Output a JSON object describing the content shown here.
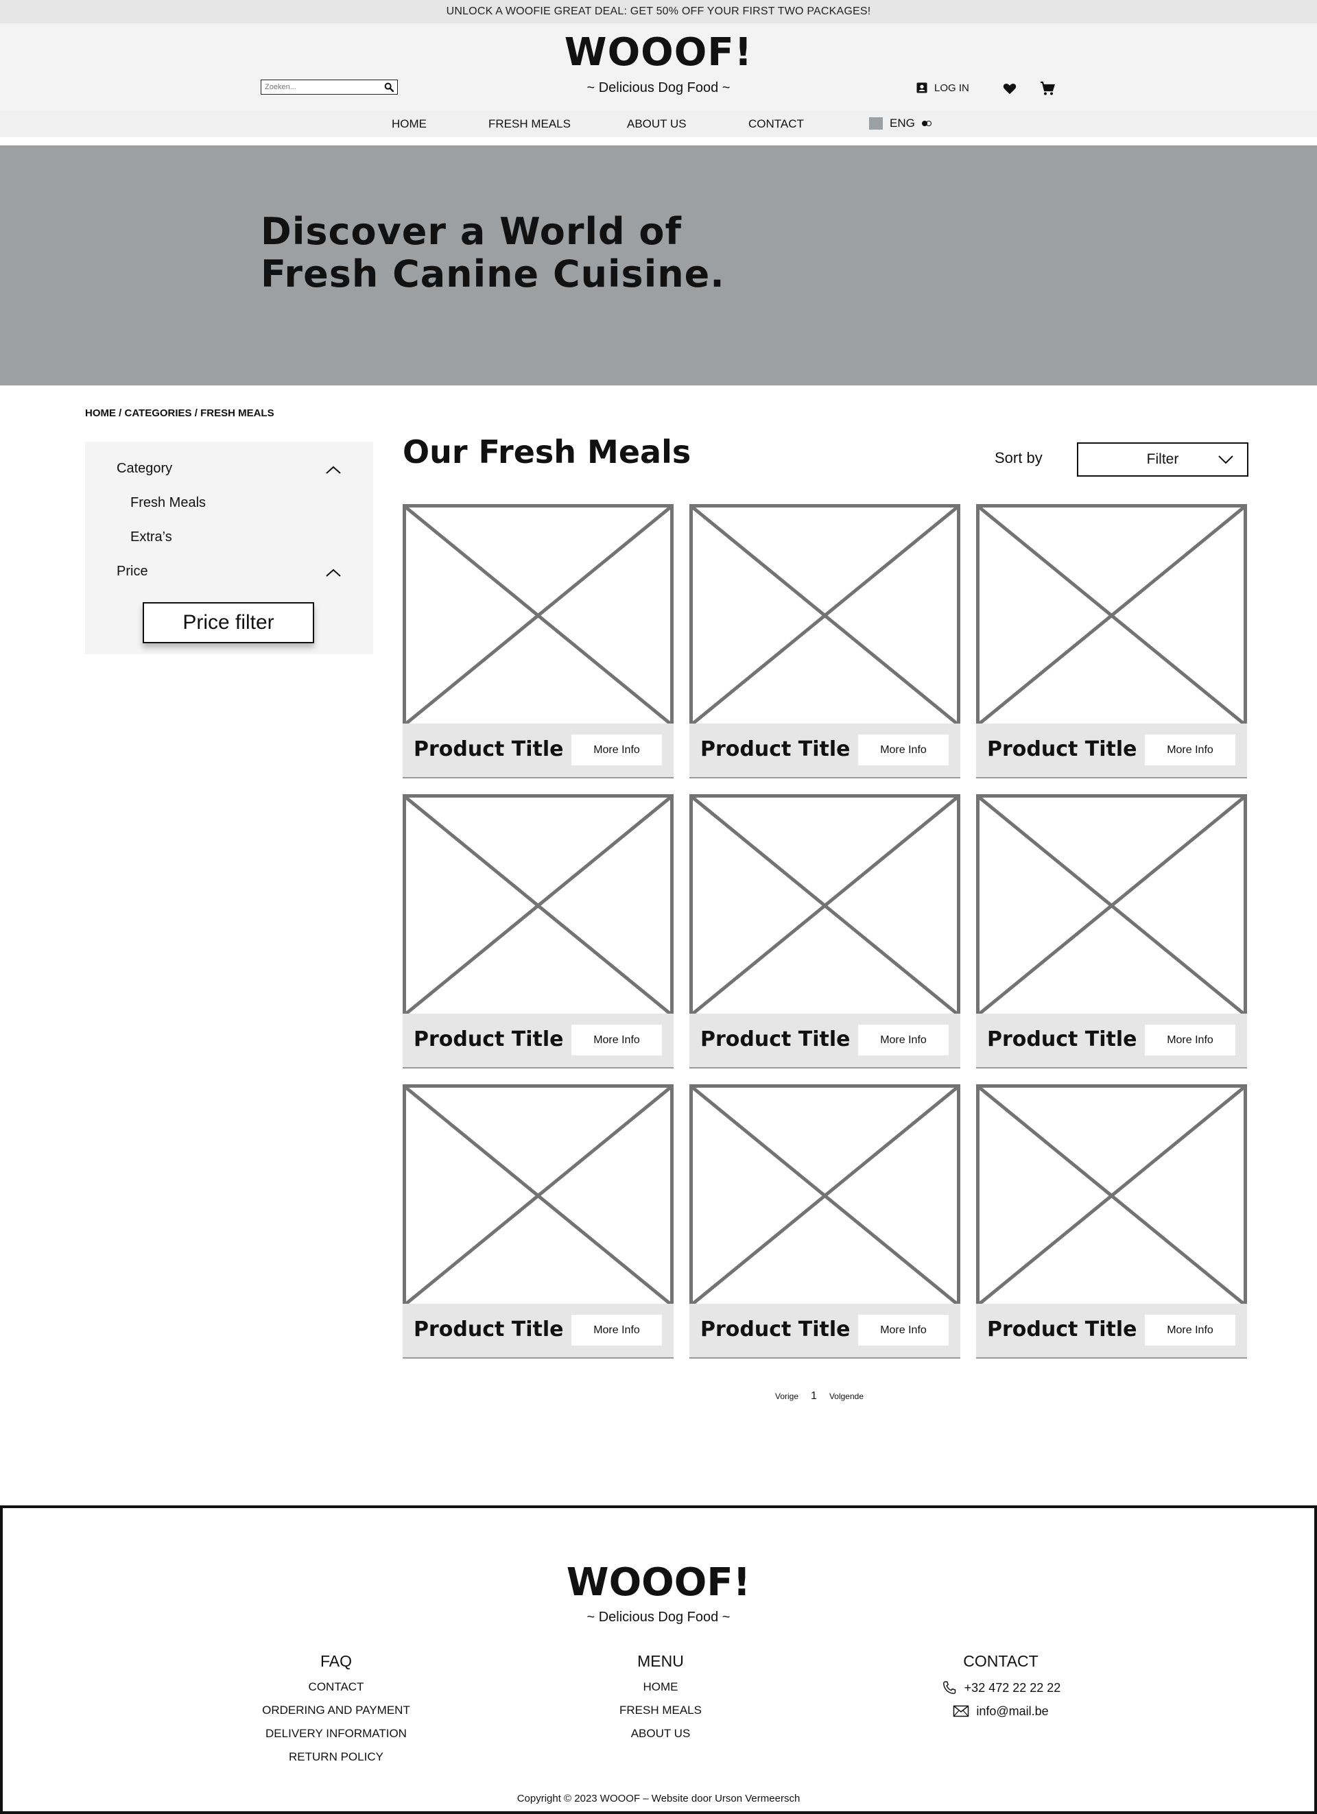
{
  "promo": {
    "text": "UNLOCK A WOOFIE GREAT DEAL: GET 50% OFF YOUR FIRST TWO PACKAGES!"
  },
  "header": {
    "logo": "WOOOF!",
    "tagline": "~ Delicious Dog Food ~",
    "search_placeholder": "Zoeken...",
    "login_label": "LOG IN"
  },
  "nav": {
    "items": [
      "HOME",
      "FRESH MEALS",
      "ABOUT US",
      "CONTACT"
    ],
    "language": "ENG"
  },
  "hero": {
    "title": "Discover a World of Fresh Canine Cuisine."
  },
  "breadcrumb": "HOME / CATEGORIES / FRESH MEALS",
  "sidebar": {
    "category_label": "Category",
    "categories": [
      "Fresh Meals",
      "Extra’s"
    ],
    "price_label": "Price",
    "price_button": "Price filter"
  },
  "main": {
    "title": "Our Fresh Meals",
    "sort_label": "Sort by",
    "sort_value": "Filter"
  },
  "products": [
    {
      "title": "Product Title",
      "button": "More Info"
    },
    {
      "title": "Product Title",
      "button": "More Info"
    },
    {
      "title": "Product Title",
      "button": "More Info"
    },
    {
      "title": "Product Title",
      "button": "More Info"
    },
    {
      "title": "Product Title",
      "button": "More Info"
    },
    {
      "title": "Product Title",
      "button": "More Info"
    },
    {
      "title": "Product Title",
      "button": "More Info"
    },
    {
      "title": "Product Title",
      "button": "More Info"
    },
    {
      "title": "Product Title",
      "button": "More Info"
    }
  ],
  "pager": {
    "prev": "Vorige",
    "current": "1",
    "next": "Volgende"
  },
  "footer": {
    "logo": "WOOOF!",
    "tagline": "~ Delicious Dog Food ~",
    "faq": {
      "title": "FAQ",
      "links": [
        "CONTACT",
        "ORDERING AND PAYMENT",
        "DELIVERY INFORMATION",
        "RETURN POLICY"
      ]
    },
    "menu": {
      "title": "MENU",
      "links": [
        "HOME",
        "FRESH MEALS",
        "ABOUT US"
      ]
    },
    "contact": {
      "title": "CONTACT",
      "phone": "+32 472 22 22 22",
      "email": "info@mail.be"
    },
    "copyright": "Copyright © 2023 WOOOF –  Website door Urson Vermeersch"
  },
  "icons": {
    "search": "search-icon",
    "login": "user-badge-icon",
    "wishlist": "heart-icon",
    "cart": "cart-icon",
    "flag": "flag-icon",
    "chevron_up": "chevron-up-icon",
    "chevron_down": "chevron-down-icon",
    "phone": "phone-icon",
    "mail": "mail-icon",
    "image_placeholder": "image-placeholder-icon"
  }
}
